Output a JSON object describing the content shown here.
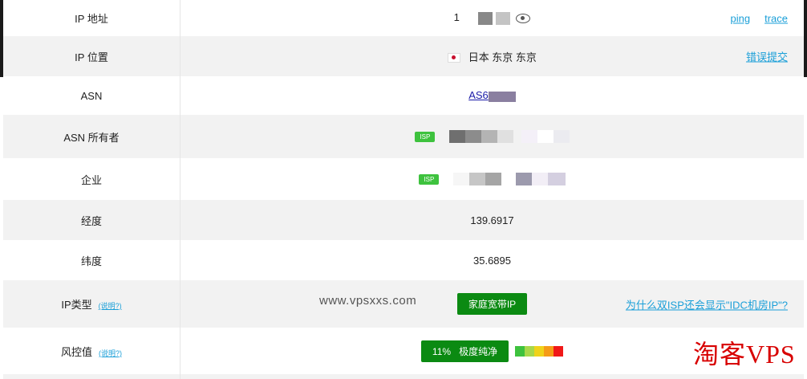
{
  "rows": {
    "ip": {
      "label": "IP 地址",
      "value": "1",
      "ping": "ping",
      "trace": "trace"
    },
    "location": {
      "label": "IP 位置",
      "value": "日本 东京 东京",
      "report": "错误提交"
    },
    "asn": {
      "label": "ASN",
      "value": "AS6"
    },
    "asn_owner": {
      "label": "ASN 所有者",
      "isp_tag": "ISP"
    },
    "company": {
      "label": "企业",
      "isp_tag": "ISP"
    },
    "longitude": {
      "label": "经度",
      "value": "139.6917"
    },
    "latitude": {
      "label": "纬度",
      "value": "35.6895"
    },
    "ip_type": {
      "label": "IP类型",
      "help": "(说明?)",
      "value": "家庭宽带IP",
      "why": "为什么双ISP还会显示\"IDC机房IP\"?"
    },
    "risk": {
      "label": "风控值",
      "help": "(说明?)",
      "percent": "11%",
      "level": "极度纯净",
      "level_percent": 11
    }
  },
  "watermark": "www.vpsxxs.com",
  "brand": "淘客VPS",
  "colors": {
    "link": "#1a9fd8",
    "badge_green": "#0b8a12",
    "isp_green": "#3ec23e",
    "brand_red": "#d80000"
  }
}
